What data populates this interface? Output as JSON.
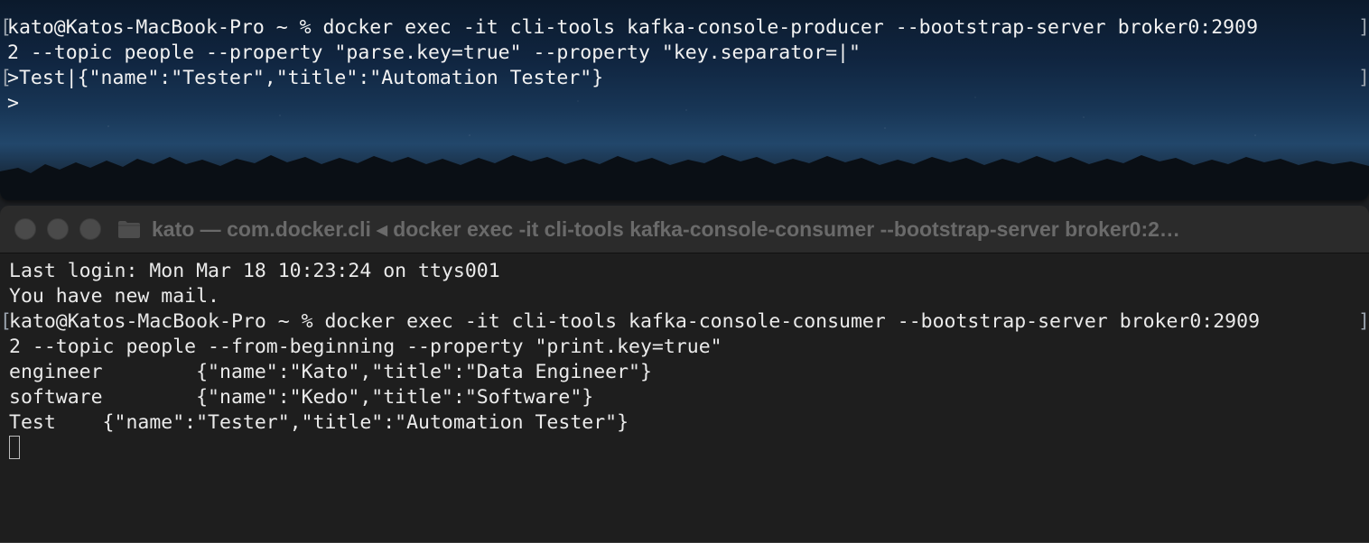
{
  "producer_terminal": {
    "lines": [
      "kato@Katos-MacBook-Pro ~ % docker exec -it cli-tools kafka-console-producer --bootstrap-server broker0:2909",
      "2 --topic people --property \"parse.key=true\" --property \"key.separator=|\"",
      ">Test|{\"name\":\"Tester\",\"title\":\"Automation Tester\"}",
      ">"
    ]
  },
  "consumer_terminal": {
    "title": "kato — com.docker.cli ◂ docker exec -it cli-tools kafka-console-consumer --bootstrap-server broker0:2…",
    "lines": [
      "Last login: Mon Mar 18 10:23:24 on ttys001",
      "You have new mail.",
      "kato@Katos-MacBook-Pro ~ % docker exec -it cli-tools kafka-console-consumer --bootstrap-server broker0:2909",
      "2 --topic people --from-beginning --property \"print.key=true\"",
      "engineer        {\"name\":\"Kato\",\"title\":\"Data Engineer\"}",
      "software        {\"name\":\"Kedo\",\"title\":\"Software\"}",
      "Test    {\"name\":\"Tester\",\"title\":\"Automation Tester\"}"
    ]
  },
  "icons": {
    "close": "close-icon",
    "minimize": "minimize-icon",
    "zoom": "zoom-icon",
    "folder": "folder-icon"
  },
  "colors": {
    "terminal_bg": "#1e1e1e",
    "titlebar_bg": "#2b2b2b",
    "text": "#eaeaea",
    "title_text": "#6a6a6a"
  }
}
